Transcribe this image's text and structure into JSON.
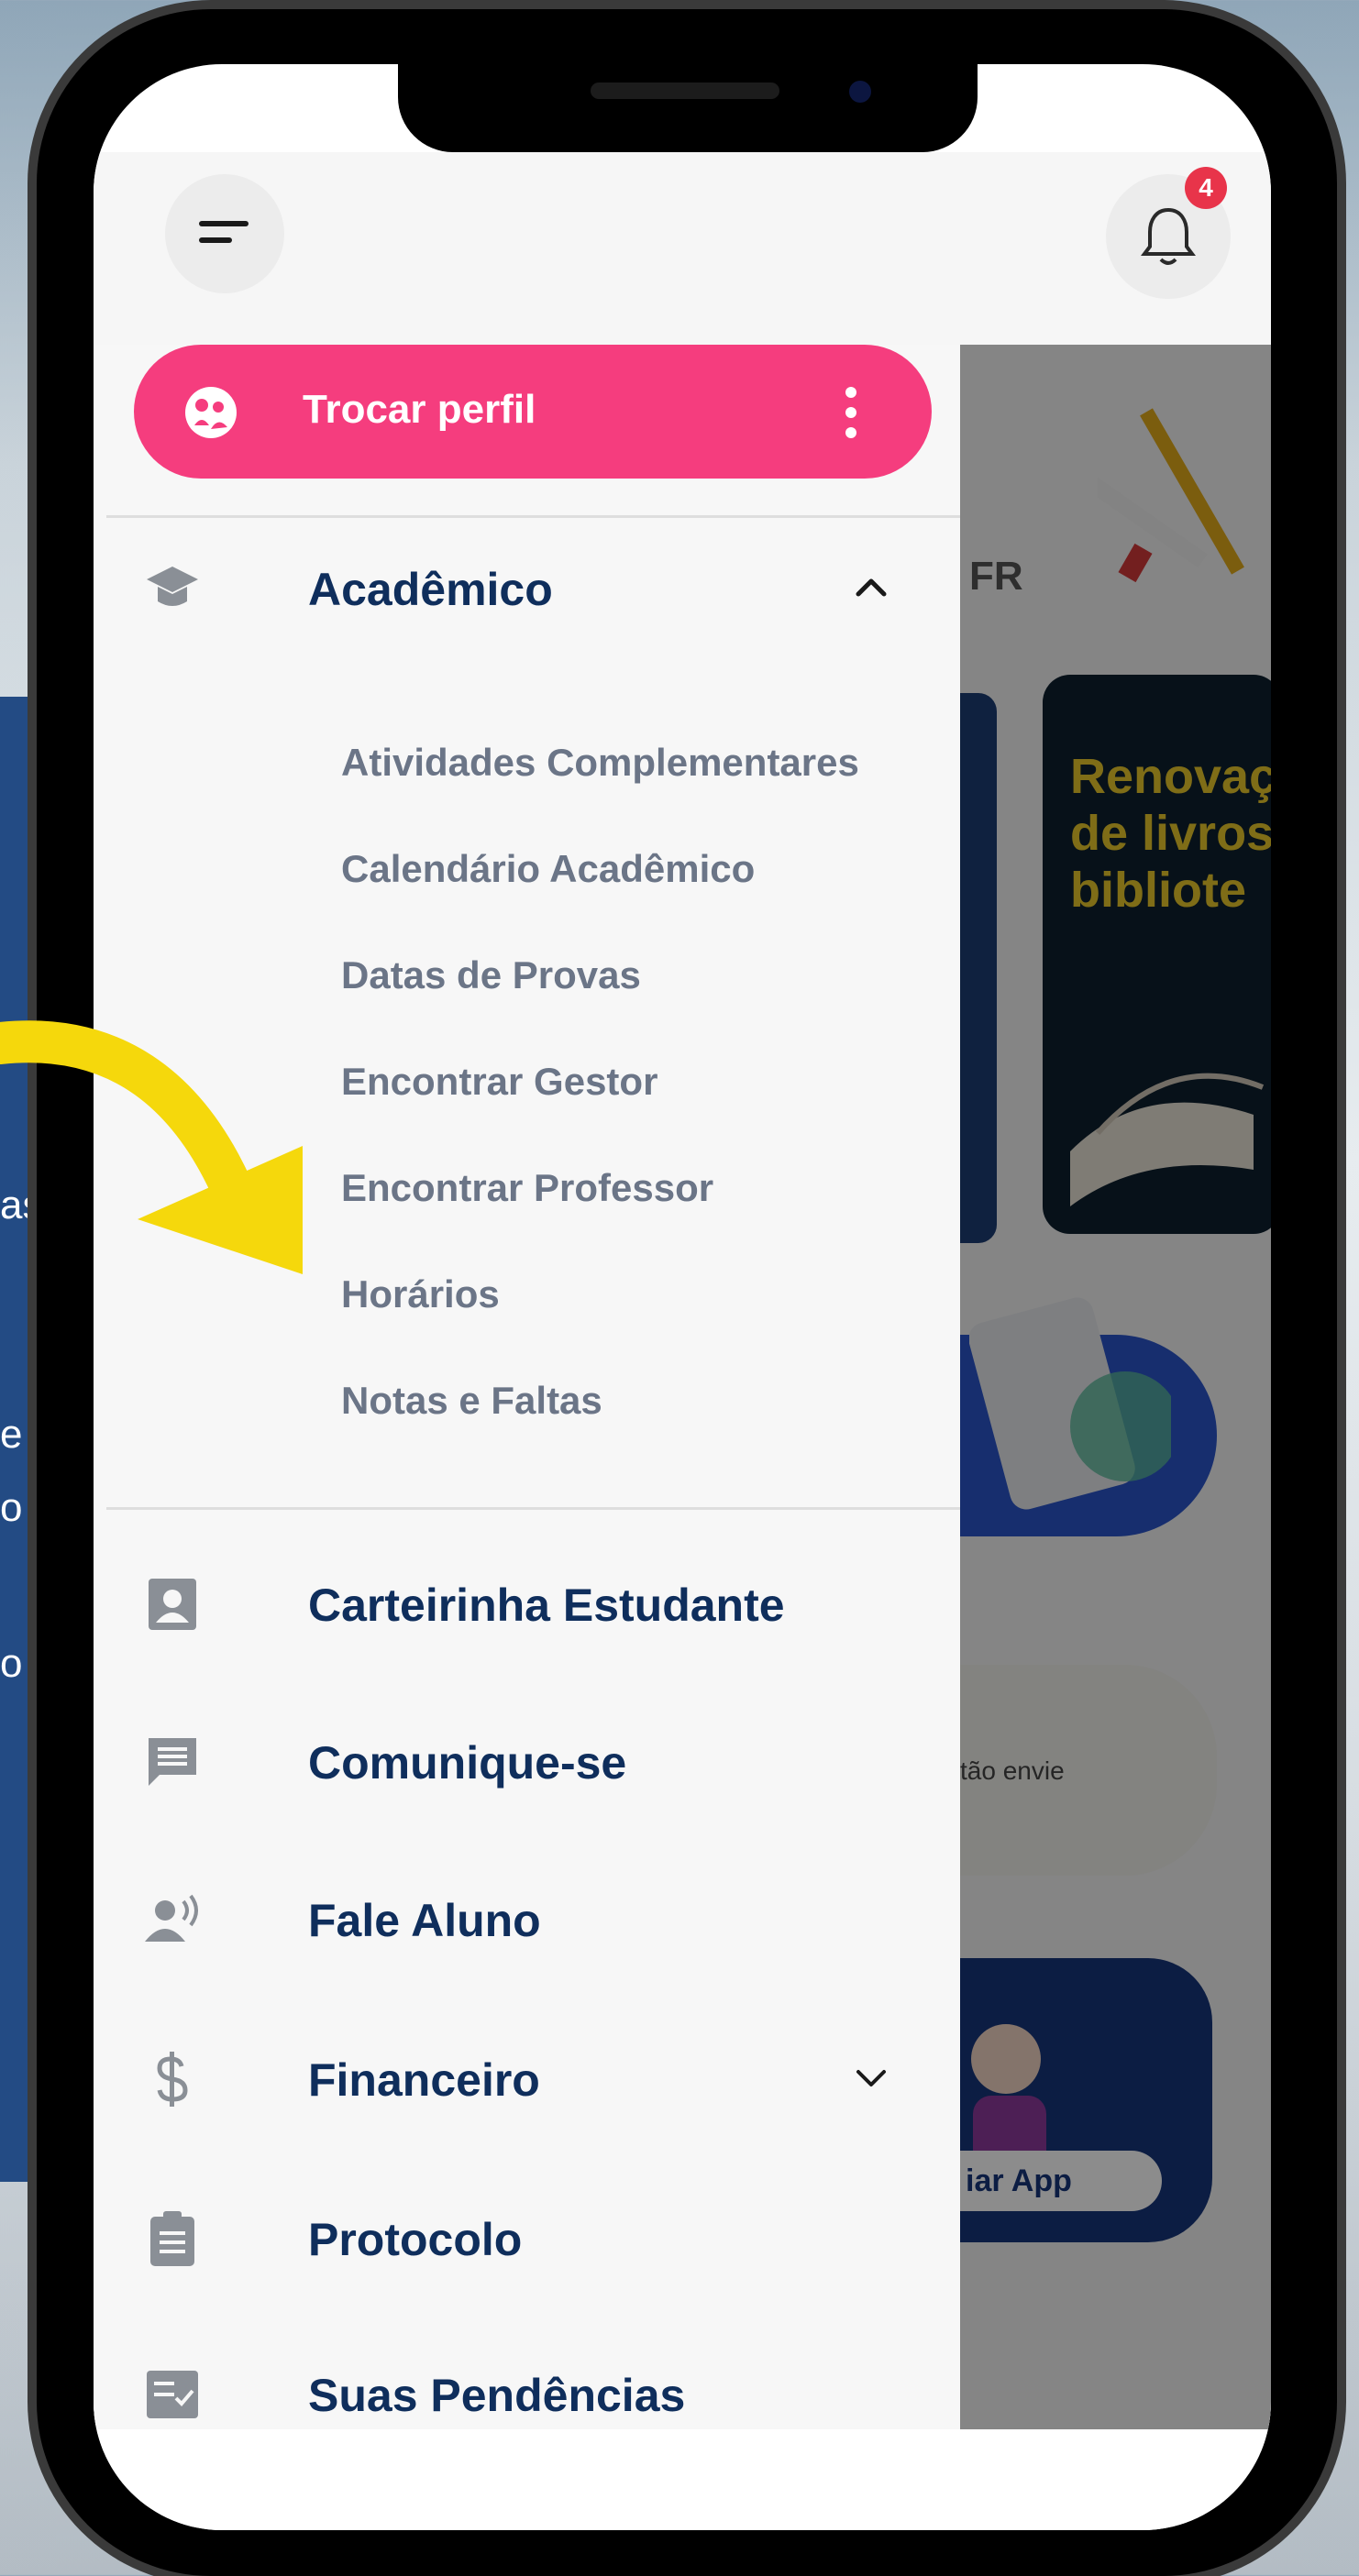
{
  "background": {
    "side_texts": [
      "as",
      "e",
      "o",
      "o"
    ]
  },
  "header": {
    "notification_count": "4",
    "menu_icon": "hamburger-icon",
    "bell_icon": "bell-icon"
  },
  "drawer": {
    "profile_button": {
      "label": "Trocar perfil",
      "icon": "profile-switch-icon"
    },
    "academic": {
      "label": "Acadêmico",
      "expanded": true,
      "items": [
        "Atividades Complementares",
        "Calendário Acadêmico",
        "Datas de Provas",
        "Encontrar Gestor",
        "Encontrar Professor",
        "Horários",
        "Notas e Faltas"
      ]
    },
    "menu": [
      {
        "label": "Carteirinha Estudante",
        "icon": "id-card-icon"
      },
      {
        "label": "Comunique-se",
        "icon": "message-icon"
      },
      {
        "label": "Fale Aluno",
        "icon": "voice-person-icon"
      },
      {
        "label": "Financeiro",
        "icon": "dollar-icon",
        "expandable": true
      },
      {
        "label": "Protocolo",
        "icon": "clipboard-icon"
      },
      {
        "label": "Suas Pendências",
        "icon": "checklist-icon"
      }
    ]
  },
  "background_app": {
    "fr_text": "FR",
    "promo_text": "Renovaç\nde livros\nbibliote",
    "card_text": "tão envie",
    "button_text": "iar App"
  },
  "colors": {
    "accent_pink": "#f53d7e",
    "nav_blue": "#0f2e5c",
    "sub_gray": "#6b7587",
    "badge_red": "#e8344a",
    "arrow_yellow": "#f5d80c"
  }
}
